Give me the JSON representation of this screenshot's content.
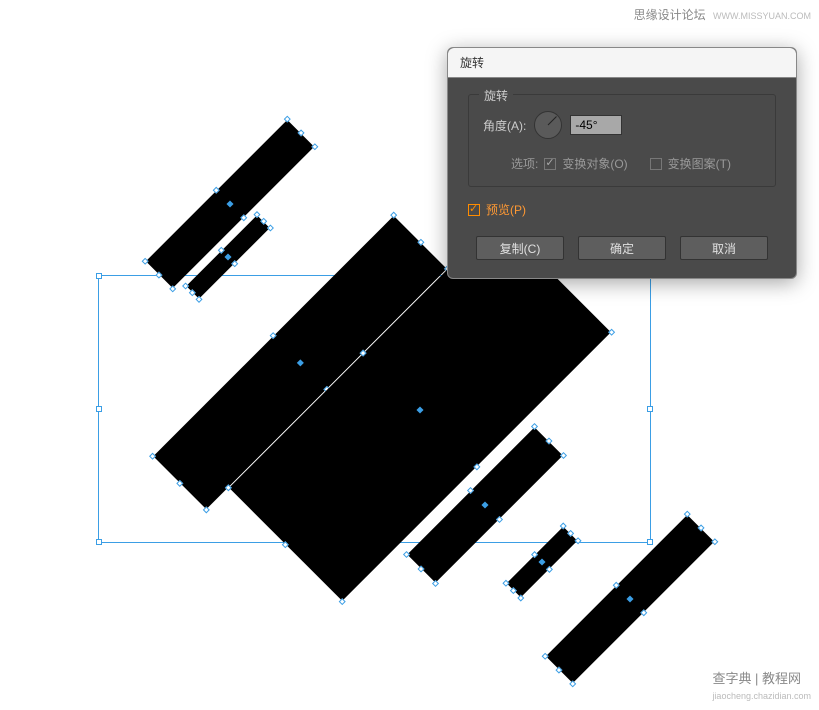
{
  "watermark": {
    "top_text": "思缘设计论坛",
    "top_url": "WWW.MISSYUAN.COM",
    "bottom_text": "查字典 | 教程网",
    "bottom_sub": "jiaocheng.chazidian.com"
  },
  "dialog": {
    "title": "旋转",
    "group_label": "旋转",
    "angle_label": "角度(A):",
    "angle_value": "-45°",
    "options_label": "选项:",
    "transform_object_label": "变换对象(O)",
    "transform_pattern_label": "变换图案(T)",
    "preview_label": "预览(P)",
    "copy_btn": "复制(C)",
    "ok_btn": "确定",
    "cancel_btn": "取消"
  }
}
